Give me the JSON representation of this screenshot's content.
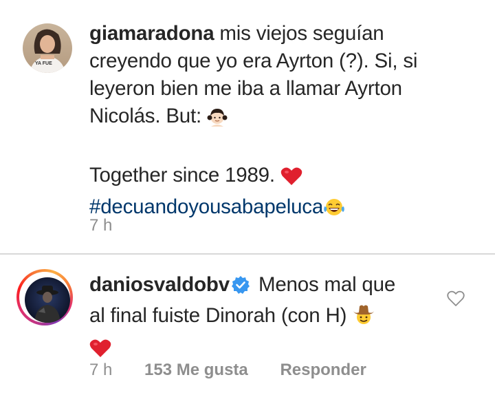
{
  "comments": [
    {
      "username": "giamaradona",
      "text_line1": "mis viejos seguían",
      "text_line2": "creyendo que yo era Ayrton (?). Si, si",
      "text_line3": "leyeron bien me iba a llamar Ayrton",
      "text_line4": "Nicolás. But:",
      "text_line5": "Together since 1989.",
      "hashtag": "#decuandoyousabapeluca",
      "avatar_badge_text": "YA FUE",
      "emoji_girl": "girl-emoji",
      "emoji_heart": "red-heart-emoji",
      "emoji_laugh": "tears-of-joy-emoji",
      "time": "7 h"
    },
    {
      "username": "daniosvaldobv",
      "verified": true,
      "text_line1": "Menos mal que",
      "text_line2": "al final fuiste Dinorah (con H)",
      "emoji_cowboy": "cowboy-emoji",
      "emoji_heart": "red-heart-emoji",
      "time": "7 h",
      "likes": "153 Me gusta",
      "reply": "Responder"
    }
  ],
  "colors": {
    "text": "#262626",
    "meta": "#8e8e8e",
    "hashtag": "#00376b",
    "verified": "#3897f0",
    "heart": "#e0202e",
    "divider": "#d8d8d8"
  }
}
